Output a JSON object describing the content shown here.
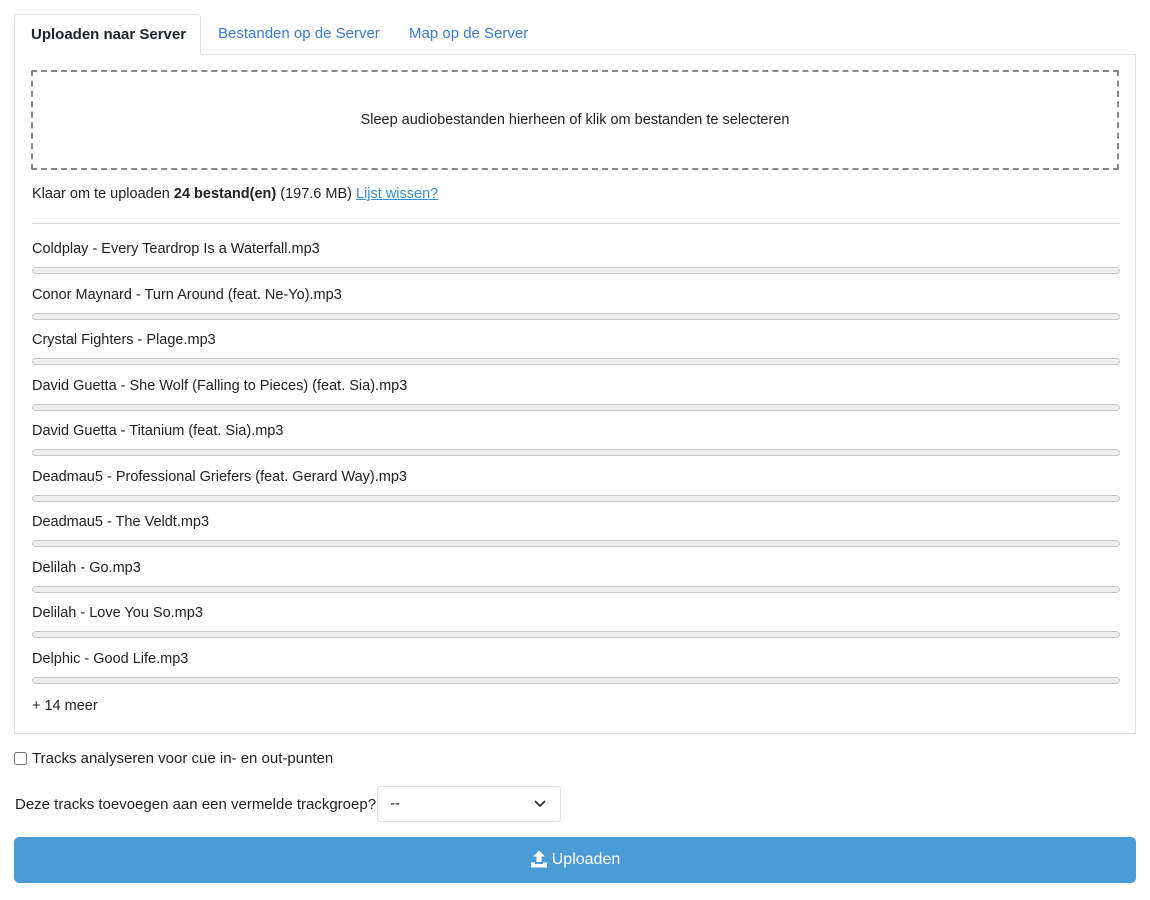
{
  "tabs": [
    {
      "label": "Uploaden naar Server",
      "active": true
    },
    {
      "label": "Bestanden op de Server",
      "active": false
    },
    {
      "label": "Map op de Server",
      "active": false
    }
  ],
  "dropzone": {
    "text": "Sleep audiobestanden hierheen of klik om bestanden te selecteren"
  },
  "status": {
    "prefix": "Klaar om te uploaden ",
    "count": "24 bestand(en)",
    "size": " (197.6 MB) ",
    "clear_link": "Lijst wissen?"
  },
  "files": [
    {
      "name": "Coldplay - Every Teardrop Is a Waterfall.mp3",
      "progress": 0
    },
    {
      "name": "Conor Maynard - Turn Around (feat. Ne-Yo).mp3",
      "progress": 0
    },
    {
      "name": "Crystal Fighters - Plage.mp3",
      "progress": 0
    },
    {
      "name": "David Guetta - She Wolf (Falling to Pieces) (feat. Sia).mp3",
      "progress": 0
    },
    {
      "name": "David Guetta - Titanium (feat. Sia).mp3",
      "progress": 0
    },
    {
      "name": "Deadmau5 - Professional Griefers (feat. Gerard Way).mp3",
      "progress": 0
    },
    {
      "name": "Deadmau5 - The Veldt.mp3",
      "progress": 0
    },
    {
      "name": "Delilah - Go.mp3",
      "progress": 0
    },
    {
      "name": "Delilah - Love You So.mp3",
      "progress": 0
    },
    {
      "name": "Delphic - Good Life.mp3",
      "progress": 0
    }
  ],
  "more_text": "+ 14 meer",
  "analyze": {
    "label": "Tracks analyseren voor cue in- en out-punten",
    "checked": false
  },
  "group": {
    "label": "Deze tracks toevoegen aan een vermelde trackgroep?",
    "selected": "--"
  },
  "upload_button": {
    "label": "Uploaden",
    "icon": "upload-icon"
  },
  "colors": {
    "accent": "#4a9bd6",
    "link": "#3a7bd5"
  }
}
